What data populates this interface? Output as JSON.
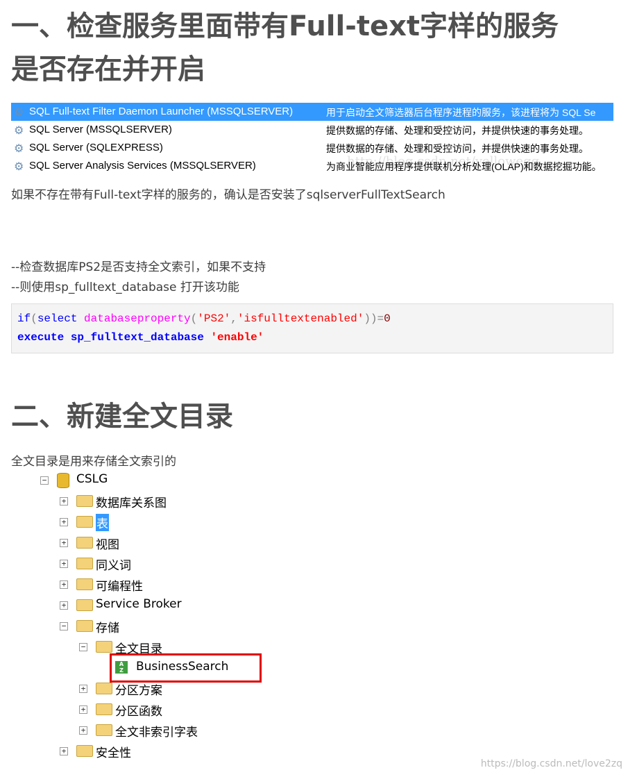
{
  "heading1_line1": "一、检查服务里面带有Full-text字样的服务",
  "heading1_line2": "是否存在并开启",
  "services": [
    {
      "name": "SQL Full-text Filter Daemon Launcher (MSSQLSERVER)",
      "desc": "用于启动全文筛选器后台程序进程的服务，该进程将为 SQL Se",
      "selected": true
    },
    {
      "name": "SQL Server (MSSQLSERVER)",
      "desc": "提供数据的存储、处理和受控访问，并提供快速的事务处理。"
    },
    {
      "name": "SQL Server (SQLEXPRESS)",
      "desc": "提供数据的存储、处理和受控访问，并提供快速的事务处理。"
    },
    {
      "name": "SQL Server Analysis Services (MSSQLSERVER)",
      "desc": "为商业智能应用程序提供联机分析处理(OLAP)和数据挖掘功能。"
    }
  ],
  "watermark1": "http://blog.csdn.net/yellowegg",
  "para1": "如果不存在带有Full-text字样的服务的，确认是否安装了sqlserverFullTextSearch",
  "comment1": "--检查数据库PS2是否支持全文索引，如果不支持",
  "comment2": "--则使用sp_fulltext_database 打开该功能",
  "code": {
    "l1_if": "if",
    "l1_p1": "(",
    "l1_select": "select ",
    "l1_fn": "databaseproperty",
    "l1_p2": "(",
    "l1_s1": "'PS2'",
    "l1_c": ",",
    "l1_s2": "'isfulltextenabled'",
    "l1_p3": "))=",
    "l1_num": "0",
    "l2_kw": "execute sp_fulltext_database ",
    "l2_str": "'enable'"
  },
  "heading2": "二、新建全文目录",
  "para2": "全文目录是用来存储全文索引的",
  "tree": {
    "root": "CSLG",
    "items": [
      "数据库关系图",
      "表",
      "视图",
      "同义词",
      "可编程性",
      "Service Broker",
      "存储",
      "全文目录",
      "BusinessSearch",
      "分区方案",
      "分区函数",
      "全文非索引字表",
      "安全性"
    ]
  },
  "footer": "https://blog.csdn.net/love2zq"
}
